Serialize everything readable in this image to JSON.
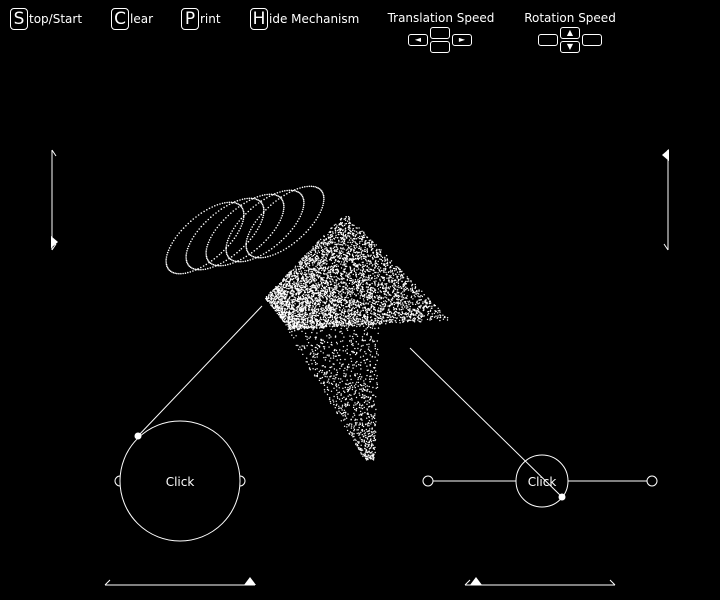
{
  "menu": {
    "stop_key": "S",
    "stop_rest": "top/Start",
    "clear_key": "C",
    "clear_rest": "lear",
    "print_key": "P",
    "print_rest": "rint",
    "hide_key": "H",
    "hide_rest": "ide Mechanism"
  },
  "translation_speed": {
    "title": "Translation Speed",
    "left_icon": "◄",
    "right_icon": "►"
  },
  "rotation_speed": {
    "title": "Rotation Speed",
    "up_icon": "▲",
    "down_icon": "▼"
  },
  "wheels": {
    "left_label": "Click",
    "right_label": "Click"
  },
  "colors": {
    "background": "#000000",
    "foreground": "#ffffff"
  }
}
